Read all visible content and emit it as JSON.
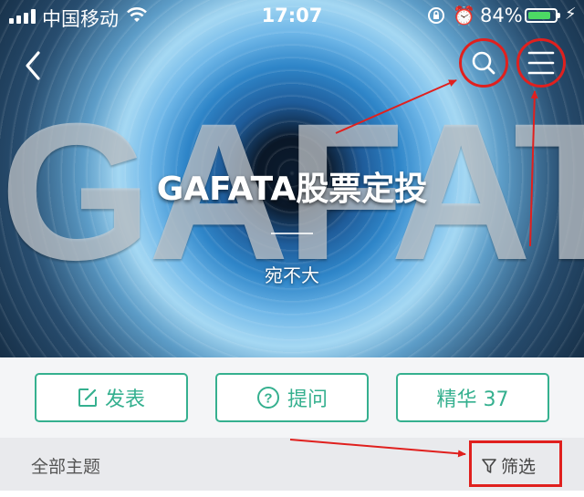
{
  "status_bar": {
    "carrier": "中国移动",
    "time": "17:07",
    "battery_percent": "84%",
    "battery_level": 0.84,
    "battery_color": "#4cd964"
  },
  "hero": {
    "background_word": "GAFATA",
    "title": "GAFATA股票定投",
    "author": "宛不大"
  },
  "nav": {
    "back_icon": "chevron-left-icon",
    "search_icon": "search-icon",
    "menu_icon": "hamburger-menu-icon"
  },
  "actions": {
    "post_label": "发表",
    "ask_label": "提问",
    "featured_label": "精华 37"
  },
  "filter_bar": {
    "topics_label": "全部主题",
    "filter_label": "筛选"
  },
  "colors": {
    "accent": "#35b08f",
    "annotation": "#e0201e"
  }
}
